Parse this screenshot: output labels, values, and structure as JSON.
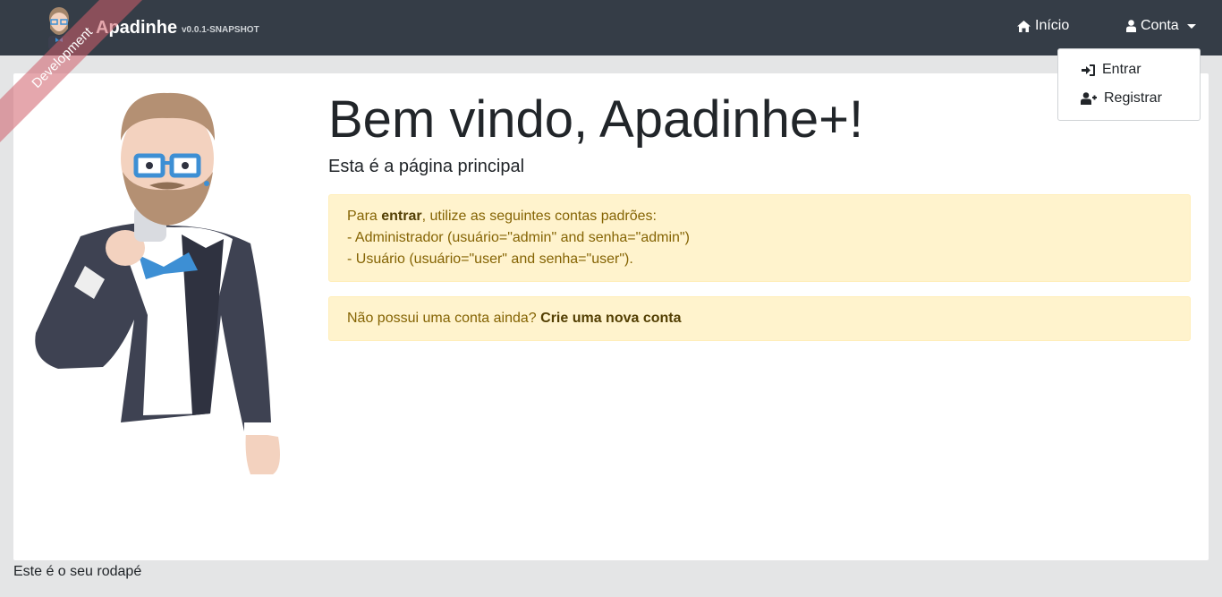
{
  "ribbon": {
    "label": "Development"
  },
  "brand": {
    "name": "Apadinhe",
    "version": "v0.0.1-SNAPSHOT"
  },
  "nav": {
    "home_label": "Início",
    "account_label": "Conta"
  },
  "account_menu": {
    "items": [
      {
        "label": "Entrar",
        "icon": "sign-in-icon"
      },
      {
        "label": "Registrar",
        "icon": "user-plus-icon"
      }
    ]
  },
  "main": {
    "title": "Bem vindo, Apadinhe+!",
    "subtitle": "Esta é a página principal",
    "alert_login": {
      "prefix": "Para ",
      "strong": "entrar",
      "suffix": ", utilize as seguintes contas padrões:",
      "line2": "- Administrador (usuário=\"admin\" and senha=\"admin\")",
      "line3": "- Usuário (usuário=\"user\" and senha=\"user\")."
    },
    "alert_register": {
      "text": "Não possui uma conta ainda? ",
      "link": "Crie uma nova conta"
    }
  },
  "footer": {
    "text": "Este é o seu rodapé"
  },
  "colors": {
    "navbar": "#353d47",
    "background": "#e4e5e6",
    "alert_bg": "#fff3cd",
    "alert_text": "#856404",
    "ribbon": "#cf5f6a"
  }
}
